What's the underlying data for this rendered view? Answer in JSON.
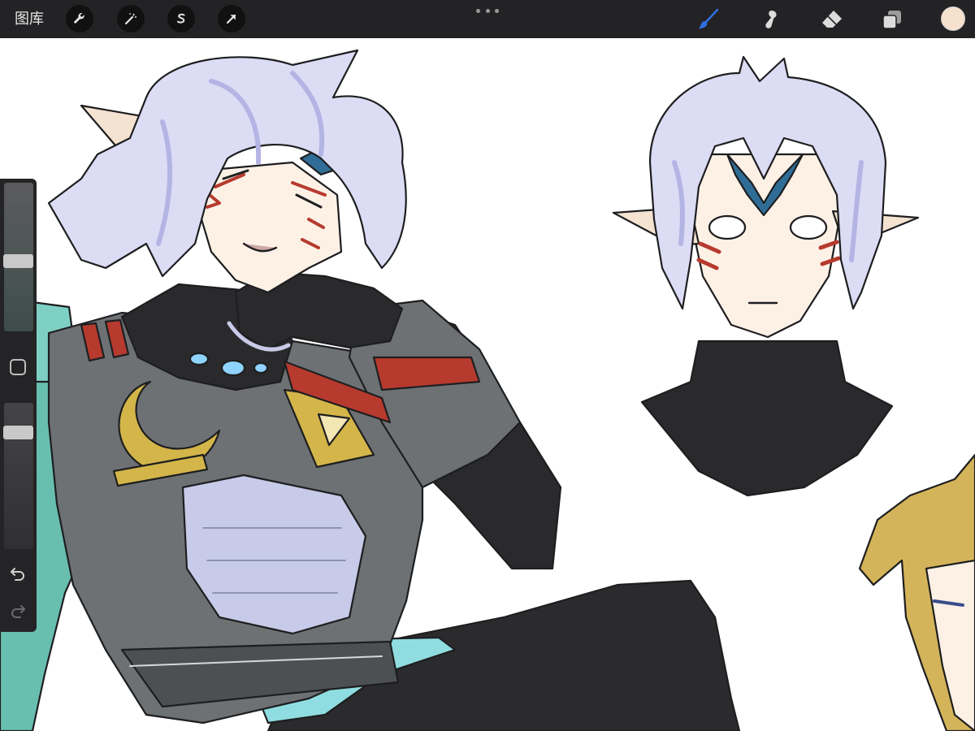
{
  "toolbar": {
    "gallery_label": "图库",
    "left_tools": [
      "wrench-icon",
      "magic-wand-icon",
      "selection-s-icon",
      "move-arrow-icon"
    ],
    "right_tools": [
      "brush-icon",
      "smudge-icon",
      "eraser-icon",
      "layers-icon"
    ],
    "active_tool": "brush",
    "active_tool_color": "#2f6fe0",
    "current_color": "#f6e1cf"
  },
  "sidebar": {
    "brush_size_level": 0.47,
    "opacity_level": 0.17,
    "modify_button": "square-icon",
    "undo": "undo-icon",
    "redo": "redo-icon"
  },
  "canvas": {
    "background": "#ffffff",
    "palette": {
      "hair": "#dcdcf5",
      "hair_shade": "#b4b4e4",
      "skin": "#fdf1e6",
      "armor": "#6d7173",
      "armor_light": "#9a9ea0",
      "gold": "#d3b54a",
      "black": "#2a2a2c",
      "teal": "#68bfb0",
      "red": "#b73a2e",
      "blonde": "#d4b45a"
    }
  }
}
